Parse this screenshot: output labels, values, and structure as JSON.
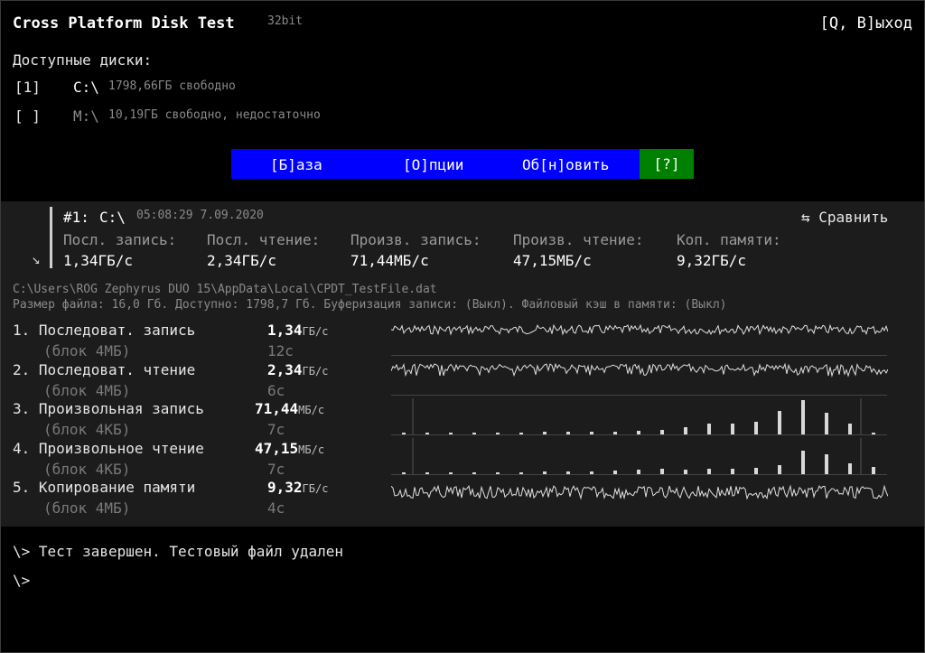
{
  "header": {
    "title": "Cross Platform Disk Test",
    "bits": "32bit",
    "exit": "[Q, В]ыход"
  },
  "disks": {
    "label": "Доступные диски:",
    "items": [
      {
        "marker": "[1]",
        "name": "C:\\",
        "info": "1798,66ГБ свободно"
      },
      {
        "marker": "[ ]",
        "name": "M:\\",
        "info": "10,19ГБ свободно, недостаточно"
      }
    ]
  },
  "menu": {
    "base": "[Б]аза",
    "options": "[О]пции",
    "refresh": "Об[н]овить",
    "help": "[?]"
  },
  "result": {
    "id": "#1:",
    "drive": "C:\\",
    "timestamp": "05:08:29 7.09.2020",
    "compare": "⇆ Сравнить",
    "arrow": "↘",
    "columns": [
      {
        "label": "Посл. запись:",
        "value": "1,34ГБ/с"
      },
      {
        "label": "Посл. чтение:",
        "value": "2,34ГБ/с"
      },
      {
        "label": "Произв. запись:",
        "value": "71,44МБ/с"
      },
      {
        "label": "Произв. чтение:",
        "value": "47,15МБ/с"
      },
      {
        "label": "Коп. памяти:",
        "value": "9,32ГБ/с"
      }
    ],
    "path": "C:\\Users\\ROG Zephyrus DUO 15\\AppData\\Local\\CPDT_TestFile.dat",
    "meta": "Размер файла: 16,0 Гб. Доступно: 1798,7 Гб. Буферизация записи: (Выкл). Файловый кэш в памяти: (Выкл)"
  },
  "tests": [
    {
      "name": "1. Последоват. запись",
      "block": "(блок 4МБ)",
      "value": "1,34",
      "unit": "ГБ/с",
      "time": "12с"
    },
    {
      "name": "2. Последоват. чтение",
      "block": "(блок 4МБ)",
      "value": "2,34",
      "unit": "ГБ/с",
      "time": "6с"
    },
    {
      "name": "3. Произвольная запись",
      "block": "(блок 4КБ)",
      "value": "71,44",
      "unit": "МБ/с",
      "time": "7с"
    },
    {
      "name": "4. Произвольное чтение",
      "block": "(блок 4КБ)",
      "value": "47,15",
      "unit": "МБ/с",
      "time": "7с"
    },
    {
      "name": "5. Копирование памяти",
      "block": "(блок 4МБ)",
      "value": "9,32",
      "unit": "ГБ/с",
      "time": "4с"
    }
  ],
  "console": [
    "\\> Тест завершен. Тестовый файл удален",
    "\\>"
  ]
}
